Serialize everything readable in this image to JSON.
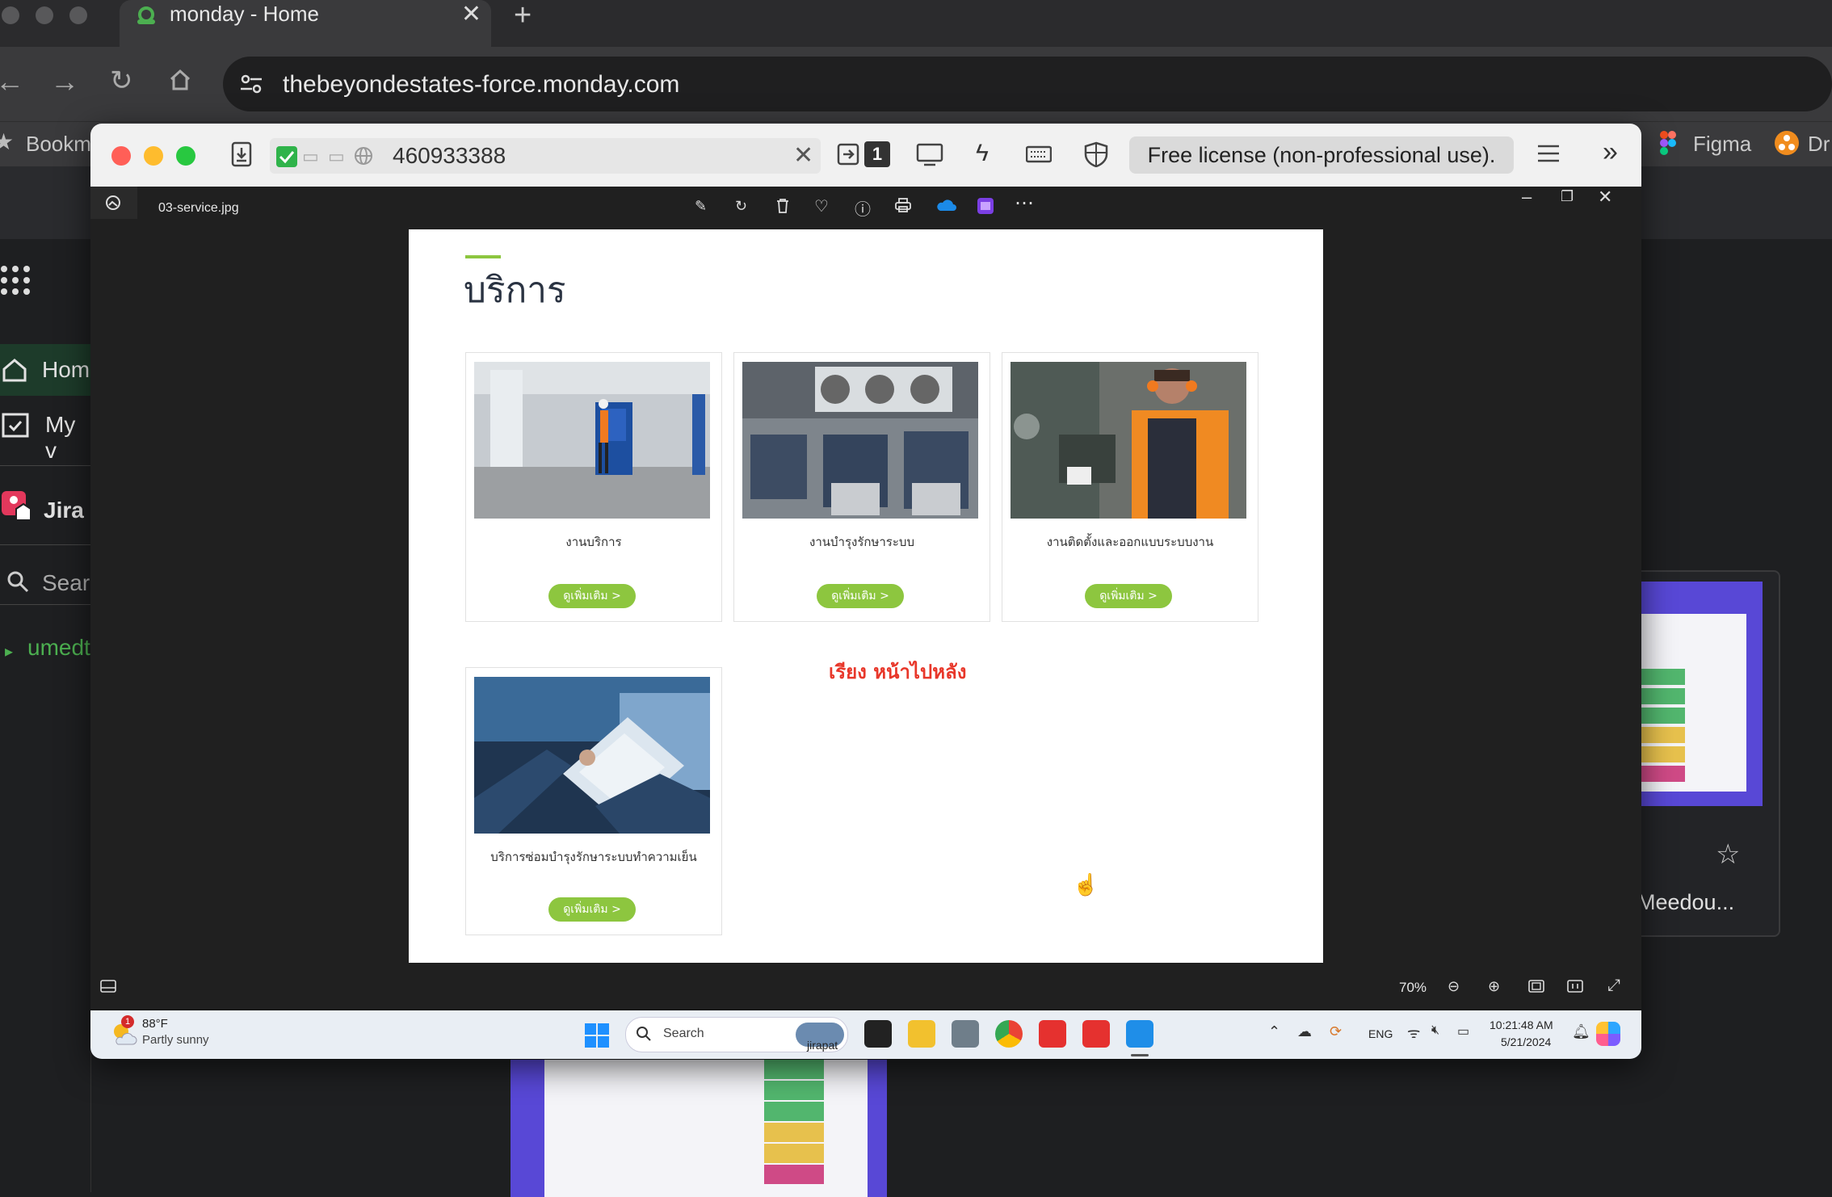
{
  "browser": {
    "tab_title": "monday - Home",
    "url": "thebeyondestates-force.monday.com",
    "bookmarks": [
      "Bookm",
      "Figma",
      "Dr"
    ]
  },
  "monday": {
    "nav": [
      "Hom",
      "My v",
      "Jira",
      "Sear",
      "umedt"
    ],
    "card_caption": "t Meedou..."
  },
  "anydesk": {
    "remote_id": "460933388",
    "license": "Free license (non-professional use).",
    "session_count": "1"
  },
  "photos": {
    "filename": "03-service.jpg",
    "zoom": "70%"
  },
  "document": {
    "heading": "บริการ",
    "cards": [
      {
        "caption": "งานบริการ",
        "button": "ดูเพิ่มเติม >"
      },
      {
        "caption": "งานบำรุงรักษาระบบ",
        "button": "ดูเพิ่มเติม >"
      },
      {
        "caption": "งานติดตั้งและออกแบบระบบงาน",
        "button": "ดูเพิ่มเติม >"
      },
      {
        "caption": "บริการซ่อมบำรุงรักษาระบบทำความเย็น",
        "button": "ดูเพิ่มเติม >"
      }
    ],
    "note": "เรียง หน้าไปหลัง"
  },
  "taskbar": {
    "weather_badge": "1",
    "temperature": "88°F",
    "weather": "Partly sunny",
    "search": "Search",
    "user": "jirapat",
    "lang": "ENG",
    "time": "10:21:48 AM",
    "date": "5/21/2024"
  },
  "colors": {
    "accent_green": "#8dc63f",
    "note_red": "#e8372a",
    "heading": "#2a3342"
  }
}
